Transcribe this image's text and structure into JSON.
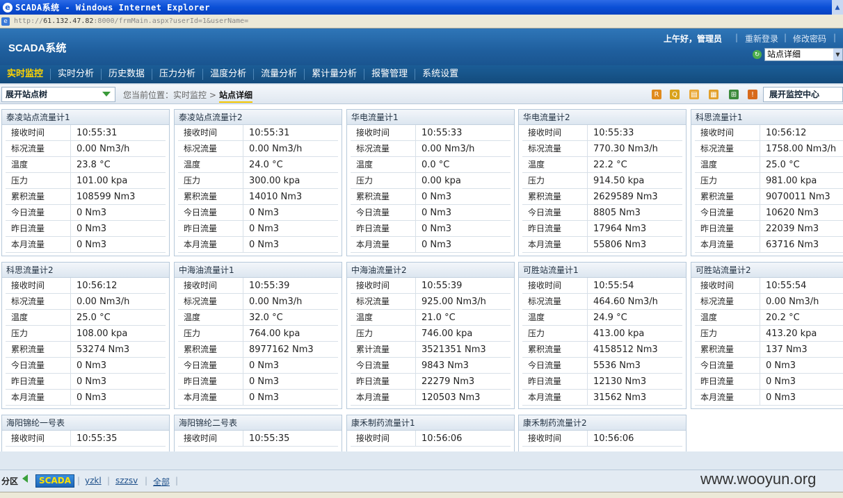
{
  "window": {
    "title": "SCADA系统 - Windows Internet Explorer",
    "url_prefix": "http://",
    "url_host": "61.132.47.82",
    "url_rest": ":8000/frmMain.aspx?userId=1&userName="
  },
  "header": {
    "logo": "SCADA系统",
    "greeting": "上午好，管理员",
    "relogin": "重新登录",
    "change_password": "修改密码",
    "view_select": "站点详细"
  },
  "nav": {
    "items": [
      "实时监控",
      "实时分析",
      "历史数据",
      "压力分析",
      "温度分析",
      "流量分析",
      "累计量分析",
      "报警管理",
      "系统设置"
    ]
  },
  "subbar": {
    "tree_button": "展开站点树",
    "breadcrumb_prefix": "您当前位置：实时监控 >",
    "breadcrumb_current": "站点详细",
    "monitor_button": "展开监控中心"
  },
  "panels": [
    {
      "title": "泰凌站点流量计1",
      "rows": [
        [
          "接收时间",
          "10:55:31"
        ],
        [
          "标况流量",
          "0.00 Nm3/h"
        ],
        [
          "温度",
          "23.8 °C"
        ],
        [
          "压力",
          "101.00 kpa"
        ],
        [
          "累积流量",
          "108599 Nm3"
        ],
        [
          "今日流量",
          "0 Nm3"
        ],
        [
          "昨日流量",
          "0 Nm3"
        ],
        [
          "本月流量",
          "0 Nm3"
        ]
      ]
    },
    {
      "title": "泰凌站点流量计2",
      "rows": [
        [
          "接收时间",
          "10:55:31"
        ],
        [
          "标况流量",
          "0.00 Nm3/h"
        ],
        [
          "温度",
          "24.0 °C"
        ],
        [
          "压力",
          "300.00 kpa"
        ],
        [
          "累积流量",
          "14010 Nm3"
        ],
        [
          "今日流量",
          "0 Nm3"
        ],
        [
          "昨日流量",
          "0 Nm3"
        ],
        [
          "本月流量",
          "0 Nm3"
        ]
      ]
    },
    {
      "title": "华电流量计1",
      "rows": [
        [
          "接收时间",
          "10:55:33"
        ],
        [
          "标况流量",
          "0.00 Nm3/h"
        ],
        [
          "温度",
          "0.0 °C"
        ],
        [
          "压力",
          "0.00 kpa"
        ],
        [
          "累积流量",
          "0 Nm3"
        ],
        [
          "今日流量",
          "0 Nm3"
        ],
        [
          "昨日流量",
          "0 Nm3"
        ],
        [
          "本月流量",
          "0 Nm3"
        ]
      ]
    },
    {
      "title": "华电流量计2",
      "rows": [
        [
          "接收时间",
          "10:55:33"
        ],
        [
          "标况流量",
          "770.30 Nm3/h"
        ],
        [
          "温度",
          "22.2 °C"
        ],
        [
          "压力",
          "914.50 kpa"
        ],
        [
          "累积流量",
          "2629589 Nm3"
        ],
        [
          "今日流量",
          "8805 Nm3"
        ],
        [
          "昨日流量",
          "17964 Nm3"
        ],
        [
          "本月流量",
          "55806 Nm3"
        ]
      ]
    },
    {
      "title": "科思流量计1",
      "rows": [
        [
          "接收时间",
          "10:56:12"
        ],
        [
          "标况流量",
          "1758.00 Nm3/h"
        ],
        [
          "温度",
          "25.0 °C"
        ],
        [
          "压力",
          "981.00 kpa"
        ],
        [
          "累积流量",
          "9070011 Nm3"
        ],
        [
          "今日流量",
          "10620 Nm3"
        ],
        [
          "昨日流量",
          "22039 Nm3"
        ],
        [
          "本月流量",
          "63716 Nm3"
        ]
      ]
    },
    {
      "title": "科思流量计2",
      "rows": [
        [
          "接收时间",
          "10:56:12"
        ],
        [
          "标况流量",
          "0.00 Nm3/h"
        ],
        [
          "温度",
          "25.0 °C"
        ],
        [
          "压力",
          "108.00 kpa"
        ],
        [
          "累积流量",
          "53274 Nm3"
        ],
        [
          "今日流量",
          "0 Nm3"
        ],
        [
          "昨日流量",
          "0 Nm3"
        ],
        [
          "本月流量",
          "0 Nm3"
        ]
      ]
    },
    {
      "title": "中海油流量计1",
      "rows": [
        [
          "接收时间",
          "10:55:39"
        ],
        [
          "标况流量",
          "0.00 Nm3/h"
        ],
        [
          "温度",
          "32.0 °C"
        ],
        [
          "压力",
          "764.00 kpa"
        ],
        [
          "累积流量",
          "8977162 Nm3"
        ],
        [
          "今日流量",
          "0 Nm3"
        ],
        [
          "昨日流量",
          "0 Nm3"
        ],
        [
          "本月流量",
          "0 Nm3"
        ]
      ]
    },
    {
      "title": "中海油流量计2",
      "rows": [
        [
          "接收时间",
          "10:55:39"
        ],
        [
          "标况流量",
          "925.00 Nm3/h"
        ],
        [
          "温度",
          "21.0 °C"
        ],
        [
          "压力",
          "746.00 kpa"
        ],
        [
          "累计流量",
          "3521351 Nm3"
        ],
        [
          "今日流量",
          "9843 Nm3"
        ],
        [
          "昨日流量",
          "22279 Nm3"
        ],
        [
          "本月流量",
          "120503 Nm3"
        ]
      ]
    },
    {
      "title": "可胜站流量计1",
      "rows": [
        [
          "接收时间",
          "10:55:54"
        ],
        [
          "标况流量",
          "464.60 Nm3/h"
        ],
        [
          "温度",
          "24.9 °C"
        ],
        [
          "压力",
          "413.00 kpa"
        ],
        [
          "累积流量",
          "4158512 Nm3"
        ],
        [
          "今日流量",
          "5536 Nm3"
        ],
        [
          "昨日流量",
          "12130 Nm3"
        ],
        [
          "本月流量",
          "31562 Nm3"
        ]
      ]
    },
    {
      "title": "可胜站流量计2",
      "rows": [
        [
          "接收时间",
          "10:55:54"
        ],
        [
          "标况流量",
          "0.00 Nm3/h"
        ],
        [
          "温度",
          "20.2 °C"
        ],
        [
          "压力",
          "413.20 kpa"
        ],
        [
          "累积流量",
          "137 Nm3"
        ],
        [
          "今日流量",
          "0 Nm3"
        ],
        [
          "昨日流量",
          "0 Nm3"
        ],
        [
          "本月流量",
          "0 Nm3"
        ]
      ]
    },
    {
      "title": "海阳锦纶一号表",
      "rows": [
        [
          "接收时间",
          "10:55:35"
        ]
      ]
    },
    {
      "title": "海阳锦纶二号表",
      "rows": [
        [
          "接收时间",
          "10:55:35"
        ]
      ]
    },
    {
      "title": "康禾制药流量计1",
      "rows": [
        [
          "接收时间",
          "10:56:06"
        ]
      ]
    },
    {
      "title": "康禾制药流量计2",
      "rows": [
        [
          "接收时间",
          "10:56:06"
        ]
      ]
    }
  ],
  "bottom": {
    "label": "分区",
    "tabs": [
      "SCADA",
      "yzkl",
      "szzsv",
      "全部"
    ],
    "watermark": "www.wooyun.org"
  }
}
